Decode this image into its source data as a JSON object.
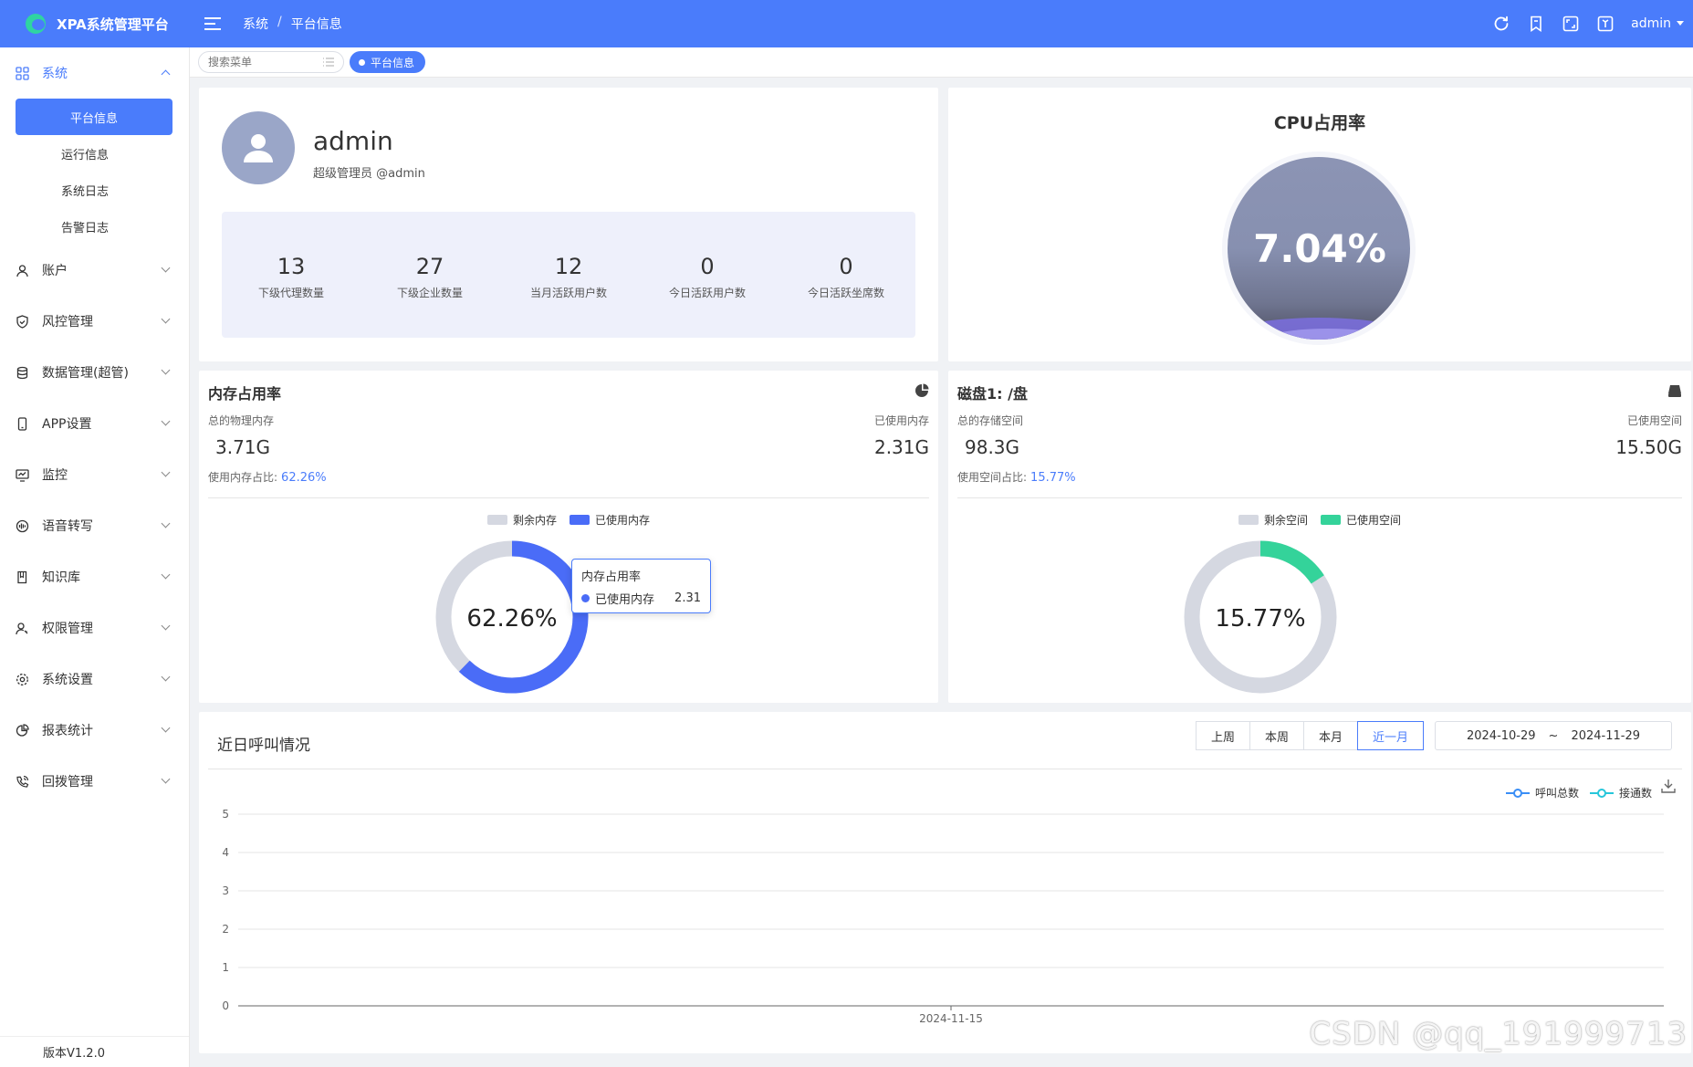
{
  "app": {
    "title": "XPA系统管理平台"
  },
  "breadcrumb": {
    "parent": "系统",
    "sep": "/",
    "current": "平台信息"
  },
  "topbar": {
    "user": "admin"
  },
  "sidebar": {
    "groups": [
      {
        "label": "系统",
        "icon": "grid-icon",
        "open": true,
        "children": [
          "平台信息",
          "运行信息",
          "系统日志",
          "告警日志"
        ]
      },
      {
        "label": "账户",
        "icon": "user-icon"
      },
      {
        "label": "风控管理",
        "icon": "shield-icon"
      },
      {
        "label": "数据管理(超管)",
        "icon": "database-icon"
      },
      {
        "label": "APP设置",
        "icon": "phone-icon"
      },
      {
        "label": "监控",
        "icon": "monitor-icon"
      },
      {
        "label": "语音转写",
        "icon": "audio-icon"
      },
      {
        "label": "知识库",
        "icon": "book-icon"
      },
      {
        "label": "权限管理",
        "icon": "user-key-icon"
      },
      {
        "label": "系统设置",
        "icon": "settings-icon"
      },
      {
        "label": "报表统计",
        "icon": "pie-icon"
      },
      {
        "label": "回拨管理",
        "icon": "phone-call-icon"
      }
    ],
    "version": "版本V1.2.0"
  },
  "tabs": {
    "search_placeholder": "搜索菜单",
    "active": "平台信息"
  },
  "profile": {
    "name": "admin",
    "role": "超级管理员 @admin",
    "stats": [
      {
        "value": "13",
        "label": "下级代理数量"
      },
      {
        "value": "27",
        "label": "下级企业数量"
      },
      {
        "value": "12",
        "label": "当月活跃用户数"
      },
      {
        "value": "0",
        "label": "今日活跃用户数"
      },
      {
        "value": "0",
        "label": "今日活跃坐席数"
      }
    ]
  },
  "cpu": {
    "title": "CPU占用率",
    "value": "7.04%",
    "fraction": 0.0704
  },
  "memory": {
    "title": "内存占用率",
    "total_label": "总的物理内存",
    "total": "3.71G",
    "used_label": "已使用内存",
    "used": "2.31G",
    "ratio_label": "使用内存占比:",
    "ratio": "62.26%",
    "legend_free": "剩余内存",
    "legend_used": "已使用内存",
    "center": "62.26%",
    "tooltip": {
      "title": "内存占用率",
      "series": "已使用内存",
      "value": "2.31"
    },
    "colors": {
      "used": "#4a6cf7",
      "free": "#d5d8e1"
    }
  },
  "disk": {
    "title": "磁盘1: /盘",
    "total_label": "总的存储空间",
    "total": "98.3G",
    "used_label": "已使用空间",
    "used": "15.50G",
    "ratio_label": "使用空间占比:",
    "ratio": "15.77%",
    "legend_free": "剩余空间",
    "legend_used": "已使用空间",
    "center": "15.77%",
    "colors": {
      "used": "#34d39a",
      "free": "#d5d8e1"
    }
  },
  "calls": {
    "title": "近日呼叫情况",
    "ranges": [
      "上周",
      "本周",
      "本月",
      "近一月"
    ],
    "active_range": "近一月",
    "date_from": "2024-10-29",
    "date_sep": "~",
    "date_to": "2024-11-29"
  },
  "chart_data": {
    "type": "line",
    "x": [
      "2024-11-15"
    ],
    "ylim": [
      0,
      5
    ],
    "yticks": [
      "0",
      "1",
      "2",
      "3",
      "4",
      "5"
    ],
    "series": [
      {
        "name": "呼叫总数",
        "color": "#3a8ef6",
        "values": [
          0
        ]
      },
      {
        "name": "接通数",
        "color": "#26c6da",
        "values": [
          0
        ]
      }
    ],
    "legend": "top-right",
    "grid": true
  },
  "watermark": "CSDN @qq_191999713"
}
